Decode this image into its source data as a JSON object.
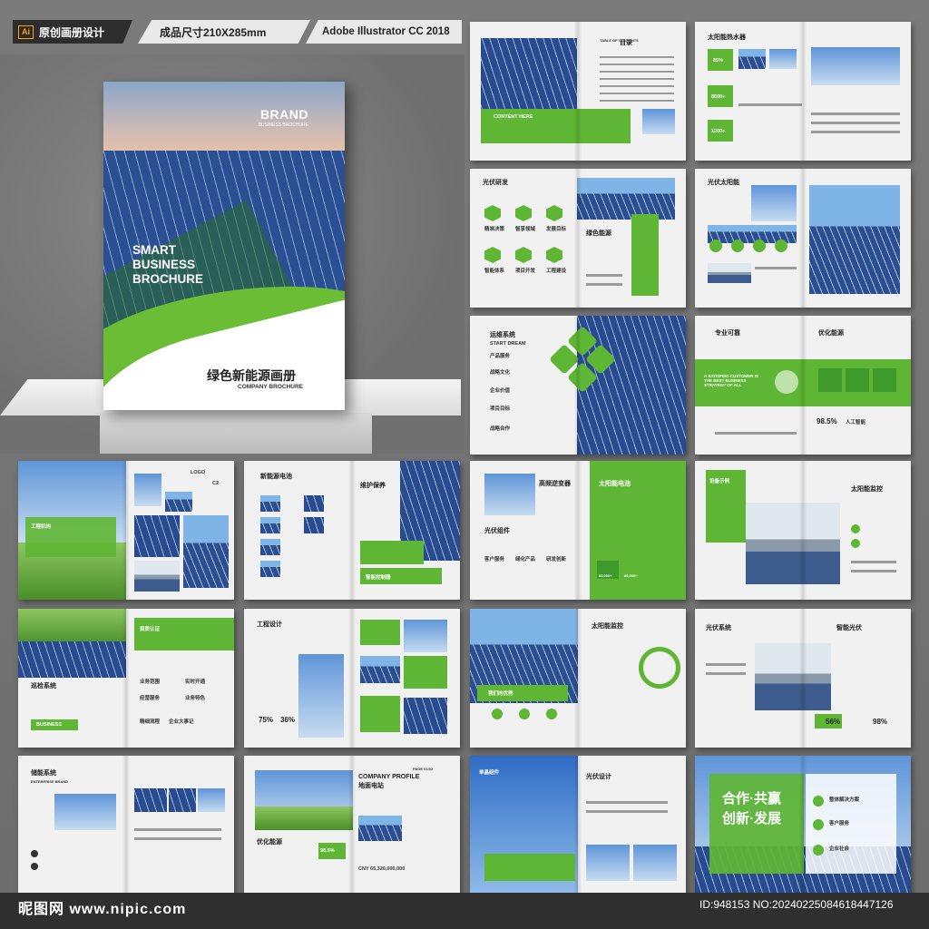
{
  "topbar": {
    "badge": "原创画册设计",
    "ai_icon": "Ai",
    "size": "成品尺寸210X285mm",
    "software": "Adobe Illustrator CC 2018"
  },
  "cover": {
    "brand": "BRAND",
    "brand_sub": "BUSINESS BROCHURE",
    "title_line1": "SMART",
    "title_line2": "BUSINESS",
    "title_line3": "BROCHURE",
    "cn_title": "绿色新能源画册",
    "en_title": "COMPANY BROCHURE"
  },
  "spreads": {
    "s1": {
      "toc": "目录",
      "toc_en": "TABLE OF CONTENTS"
    },
    "s2": {
      "title": "太阳能热水器",
      "en": "CONTENT HERE",
      "n1": "85%",
      "n2": "8500+",
      "n3": "1200+"
    },
    "s3": {
      "title": "光伏研发",
      "en": "OUR SERVICES",
      "green": "绿色能源",
      "items": [
        "精准决策",
        "智享领域",
        "发展目标",
        "智能体系",
        "项目开发",
        "工程建设"
      ]
    },
    "s4": {
      "title": "光伏太阳能",
      "en": "CONTENT HERE"
    },
    "s5": {
      "title": "运维系统",
      "en": "CONTENT HERE",
      "sub": "START DREAM",
      "items": [
        "产品服务",
        "战略文化",
        "企业价值",
        "项目目标",
        "战略合作"
      ]
    },
    "s6": {
      "title1": "专业可靠",
      "title2": "优化能源",
      "en": "OVERALL SOLUTION",
      "slogan": "A SATISFIED CUSTOMER IS THE BEST BUSINESS STRATEGY OF ALL",
      "pct": "98.5%",
      "label": "人工智能"
    },
    "s7": {
      "logo": "LOGO",
      "code": "C2",
      "label": "工程机构"
    },
    "s8": {
      "title": "新能源电池",
      "en": "INTRODUCING THE TEAM",
      "title2": "维护保养",
      "en2": "DEVELOPMENT GOAL",
      "brand": "智能控制器"
    },
    "s9": {
      "title": "高频逆变器",
      "en": "CREATIVE / DESIGN",
      "title2": "光伏组件",
      "en2": "WELCOME TO COMPANY",
      "title3": "太阳能电池",
      "n1": "85,000+",
      "n2": "85,000+",
      "items": [
        "客户服务",
        "绿化产品",
        "研发创新"
      ]
    },
    "s10": {
      "title": "设备示例",
      "en": "TONGRO BUSINESS",
      "title2": "太阳能监控",
      "en2": "TONGRO BUSINESS"
    },
    "s11": {
      "title": "资质认证",
      "en": "FUTURE EXPECTATION",
      "title2": "巡检系统",
      "en2": "CREAMAKE SERVICE WORKS",
      "btn": "BUSINESS",
      "items": [
        "业务范围",
        "实时开通",
        "经营服务",
        "业务特色",
        "精细流程",
        "企业大事记"
      ]
    },
    "s12": {
      "title": "工程设计",
      "en": "CONTENT HERE",
      "p1": "75%",
      "p2": "36%"
    },
    "s13": {
      "title": "太阳能监控",
      "en": "SINCE THE FOUNDING",
      "label": "我们的优势"
    },
    "s14": {
      "title": "光伏系统",
      "en": "OUR ADVANTAGES",
      "title2": "智能光伏",
      "p1": "56%",
      "p2": "98%"
    },
    "s15": {
      "title": "储能系统",
      "en": "ENTERPRISE BRAND"
    },
    "s16": {
      "title": "优化能源",
      "en": "CONTENT HERE",
      "pct": "98.5%",
      "cp": "COMPANY PROFILE",
      "cp2": "地面电站",
      "page": "PAGE 01/02",
      "money": "CNY 65,320,000,000"
    },
    "s17": {
      "title": "单晶组件",
      "en": "ENVATO MARKET CO INTERNATIONAL",
      "title2": "光伏设计",
      "en2": "CONTENT HERE"
    },
    "s18": {
      "line1": "合作·共赢",
      "line2": "创新·发展",
      "items": [
        "整体解决方案",
        "客户服务",
        "企业社会"
      ]
    }
  },
  "footer": {
    "site": "昵图网 www.nipic.com",
    "id": "ID:948153 NO:20240225084618447126"
  }
}
